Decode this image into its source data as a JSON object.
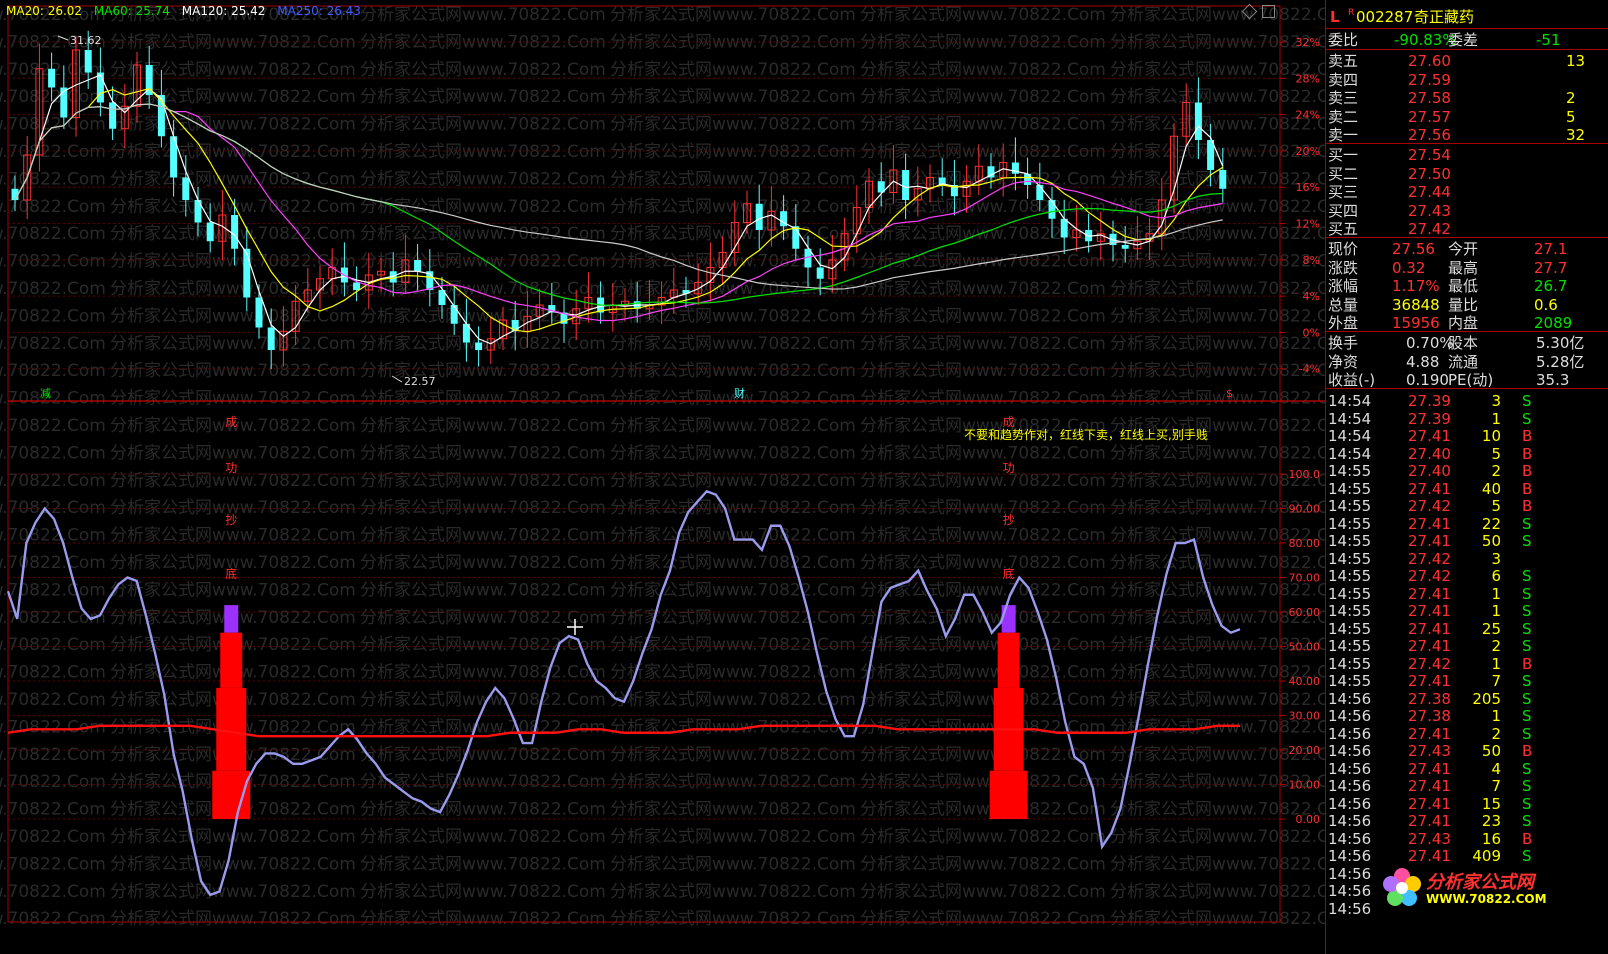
{
  "ma_legend": [
    {
      "label": "MA20: 26.02",
      "color": "#ffff00"
    },
    {
      "label": "MA60: 25.74",
      "color": "#00e000"
    },
    {
      "label": "MA120: 25.42",
      "color": "#ffffff"
    },
    {
      "label": "MA250: 26.43",
      "color": "#4060ff"
    }
  ],
  "price_high_label": "31.62",
  "price_low_label": "22.57",
  "price_axis": [
    "32%",
    "28%",
    "24%",
    "20%",
    "16%",
    "12%",
    "8%",
    "4%",
    "0%",
    "-4%"
  ],
  "indicator_axis": [
    "100.0",
    "90.00",
    "80.00",
    "70.00",
    "60.00",
    "50.00",
    "40.00",
    "30.00",
    "20.00",
    "10.00",
    "0.00"
  ],
  "markers": {
    "jian": "减",
    "cai": "财",
    "s": "$"
  },
  "signal_chars": [
    "成",
    "功",
    "抄",
    "底"
  ],
  "annotation": "不要和趋势作对，红线下卖，红线上买,别手贱",
  "watermark": "分析家公式网www.70822.Com",
  "stock": {
    "flag": "L",
    "r": "R",
    "code": "002287",
    "name": "奇正藏药"
  },
  "weibi": {
    "label": "委比",
    "value": "-90.83%",
    "label2": "委差",
    "value2": "-51"
  },
  "sell": [
    {
      "label": "卖五",
      "price": "27.60",
      "vol": "13"
    },
    {
      "label": "卖四",
      "price": "27.59",
      "vol": ""
    },
    {
      "label": "卖三",
      "price": "27.58",
      "vol": "2"
    },
    {
      "label": "卖二",
      "price": "27.57",
      "vol": "5"
    },
    {
      "label": "卖一",
      "price": "27.56",
      "vol": "32"
    }
  ],
  "buy": [
    {
      "label": "买一",
      "price": "27.54",
      "vol": ""
    },
    {
      "label": "买二",
      "price": "27.50",
      "vol": ""
    },
    {
      "label": "买三",
      "price": "27.44",
      "vol": ""
    },
    {
      "label": "买四",
      "price": "27.43",
      "vol": ""
    },
    {
      "label": "买五",
      "price": "27.42",
      "vol": ""
    }
  ],
  "quote": [
    {
      "l1": "现价",
      "v1": "27.56",
      "l2": "今开",
      "v2": "27.1"
    },
    {
      "l1": "涨跌",
      "v1": "0.32",
      "l2": "最高",
      "v2": "27.7"
    },
    {
      "l1": "涨幅",
      "v1": "1.17%",
      "l2": "最低",
      "v2": "26.7"
    },
    {
      "l1": "总量",
      "v1": "36848",
      "l2": "量比",
      "v2": "0.6"
    },
    {
      "l1": "外盘",
      "v1": "15956",
      "l2": "内盘",
      "v2": "2089"
    }
  ],
  "fund": [
    {
      "l1": "换手",
      "v1": "0.70%",
      "l2": "股本",
      "v2": "5.30亿"
    },
    {
      "l1": "净资",
      "v1": "4.88",
      "l2": "流通",
      "v2": "5.28亿"
    },
    {
      "l1": "收益(-)",
      "v1": "0.190",
      "l2": "PE(动)",
      "v2": "35.3"
    }
  ],
  "ticks": [
    {
      "t": "14:54",
      "p": "27.39",
      "v": "3",
      "d": "S"
    },
    {
      "t": "14:54",
      "p": "27.39",
      "v": "1",
      "d": "S"
    },
    {
      "t": "14:54",
      "p": "27.41",
      "v": "10",
      "d": "B"
    },
    {
      "t": "14:54",
      "p": "27.40",
      "v": "5",
      "d": "B"
    },
    {
      "t": "14:55",
      "p": "27.40",
      "v": "2",
      "d": "B"
    },
    {
      "t": "14:55",
      "p": "27.41",
      "v": "40",
      "d": "B"
    },
    {
      "t": "14:55",
      "p": "27.42",
      "v": "5",
      "d": "B"
    },
    {
      "t": "14:55",
      "p": "27.41",
      "v": "22",
      "d": "S"
    },
    {
      "t": "14:55",
      "p": "27.41",
      "v": "50",
      "d": "S"
    },
    {
      "t": "14:55",
      "p": "27.42",
      "v": "3",
      "d": ""
    },
    {
      "t": "14:55",
      "p": "27.42",
      "v": "6",
      "d": "S"
    },
    {
      "t": "14:55",
      "p": "27.41",
      "v": "1",
      "d": "S"
    },
    {
      "t": "14:55",
      "p": "27.41",
      "v": "1",
      "d": "S"
    },
    {
      "t": "14:55",
      "p": "27.41",
      "v": "25",
      "d": "S"
    },
    {
      "t": "14:55",
      "p": "27.41",
      "v": "2",
      "d": "S"
    },
    {
      "t": "14:55",
      "p": "27.42",
      "v": "1",
      "d": "B"
    },
    {
      "t": "14:55",
      "p": "27.41",
      "v": "7",
      "d": "S"
    },
    {
      "t": "14:56",
      "p": "27.38",
      "v": "205",
      "d": "S"
    },
    {
      "t": "14:56",
      "p": "27.38",
      "v": "1",
      "d": "S"
    },
    {
      "t": "14:56",
      "p": "27.41",
      "v": "2",
      "d": "S"
    },
    {
      "t": "14:56",
      "p": "27.43",
      "v": "50",
      "d": "B"
    },
    {
      "t": "14:56",
      "p": "27.41",
      "v": "4",
      "d": "S"
    },
    {
      "t": "14:56",
      "p": "27.41",
      "v": "7",
      "d": "S"
    },
    {
      "t": "14:56",
      "p": "27.41",
      "v": "15",
      "d": "S"
    },
    {
      "t": "14:56",
      "p": "27.41",
      "v": "23",
      "d": "S"
    },
    {
      "t": "14:56",
      "p": "27.43",
      "v": "16",
      "d": "B"
    },
    {
      "t": "14:56",
      "p": "27.41",
      "v": "409",
      "d": "S"
    },
    {
      "t": "14:56",
      "p": "",
      "v": "",
      "d": ""
    },
    {
      "t": "14:56",
      "p": "",
      "v": "",
      "d": ""
    },
    {
      "t": "14:56",
      "p": "",
      "v": "",
      "d": ""
    }
  ],
  "logo": {
    "title": "分析家公式网",
    "url": "WWW.70822.COM"
  },
  "indicator_series": [
    66,
    58,
    80,
    86,
    90,
    87,
    80,
    70,
    61,
    58,
    59,
    64,
    68,
    70,
    69,
    59,
    48,
    36,
    19,
    8,
    -6,
    -18,
    -22,
    -21,
    -12,
    2,
    11,
    16,
    19,
    19,
    18,
    16,
    16,
    17,
    18,
    21,
    24,
    26,
    23,
    19,
    16,
    12,
    10,
    8,
    6,
    5,
    3,
    2,
    7,
    13,
    20,
    28,
    34,
    38,
    35,
    29,
    22,
    22,
    34,
    44,
    51,
    53,
    52,
    45,
    40,
    38,
    35,
    34,
    40,
    48,
    55,
    65,
    72,
    83,
    89,
    92,
    95,
    94,
    90,
    81,
    81,
    81,
    78,
    85,
    85,
    79,
    70,
    60,
    48,
    37,
    29,
    24,
    24,
    33,
    48,
    63,
    67,
    68,
    69,
    72,
    66,
    61,
    53,
    58,
    65,
    65,
    60,
    54,
    57,
    65,
    70,
    67,
    60,
    52,
    41,
    28,
    18,
    16,
    9,
    -8,
    -4,
    3,
    16,
    30,
    45,
    59,
    71,
    80,
    80,
    81,
    70,
    62,
    56,
    54,
    55
  ],
  "ma_red_series": [
    25,
    26,
    26,
    26,
    27,
    27,
    27,
    27,
    27,
    26,
    25,
    24,
    24,
    24,
    24,
    24,
    24,
    24,
    24,
    24,
    24,
    24,
    25,
    25,
    25,
    26,
    26,
    25,
    25,
    25,
    26,
    26,
    26,
    27,
    27,
    27,
    27,
    27,
    27,
    26,
    26,
    26,
    26,
    26,
    26,
    26,
    25,
    25,
    25,
    25,
    26,
    26,
    26,
    27,
    27
  ],
  "bar_signals": [
    {
      "x_index": 25,
      "purple": [
        54,
        62
      ],
      "red": [
        38,
        54
      ]
    },
    {
      "x_index": 117,
      "purple": [
        54,
        62
      ],
      "red": [
        38,
        54
      ]
    }
  ]
}
